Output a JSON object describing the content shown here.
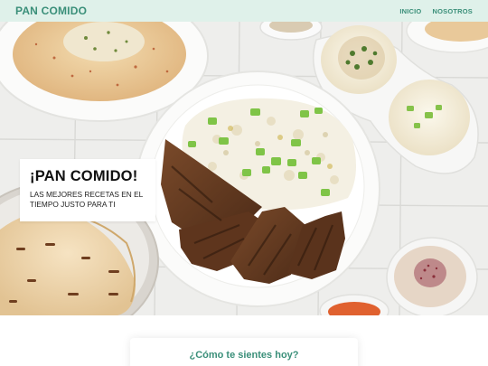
{
  "nav": {
    "brand": "PAN COMIDO",
    "links": [
      {
        "label": "INICIO"
      },
      {
        "label": "NOSOTROS"
      }
    ]
  },
  "hero": {
    "title": "¡PAN COMIDO!",
    "subtitle": "LAS MEJORES RECETAS EN EL TIEMPO JUSTO PARA TI"
  },
  "mood": {
    "question": "¿Cómo te sientes hoy?"
  },
  "colors": {
    "accent": "#3a8f79",
    "topbar_bg": "#dff1ea"
  }
}
